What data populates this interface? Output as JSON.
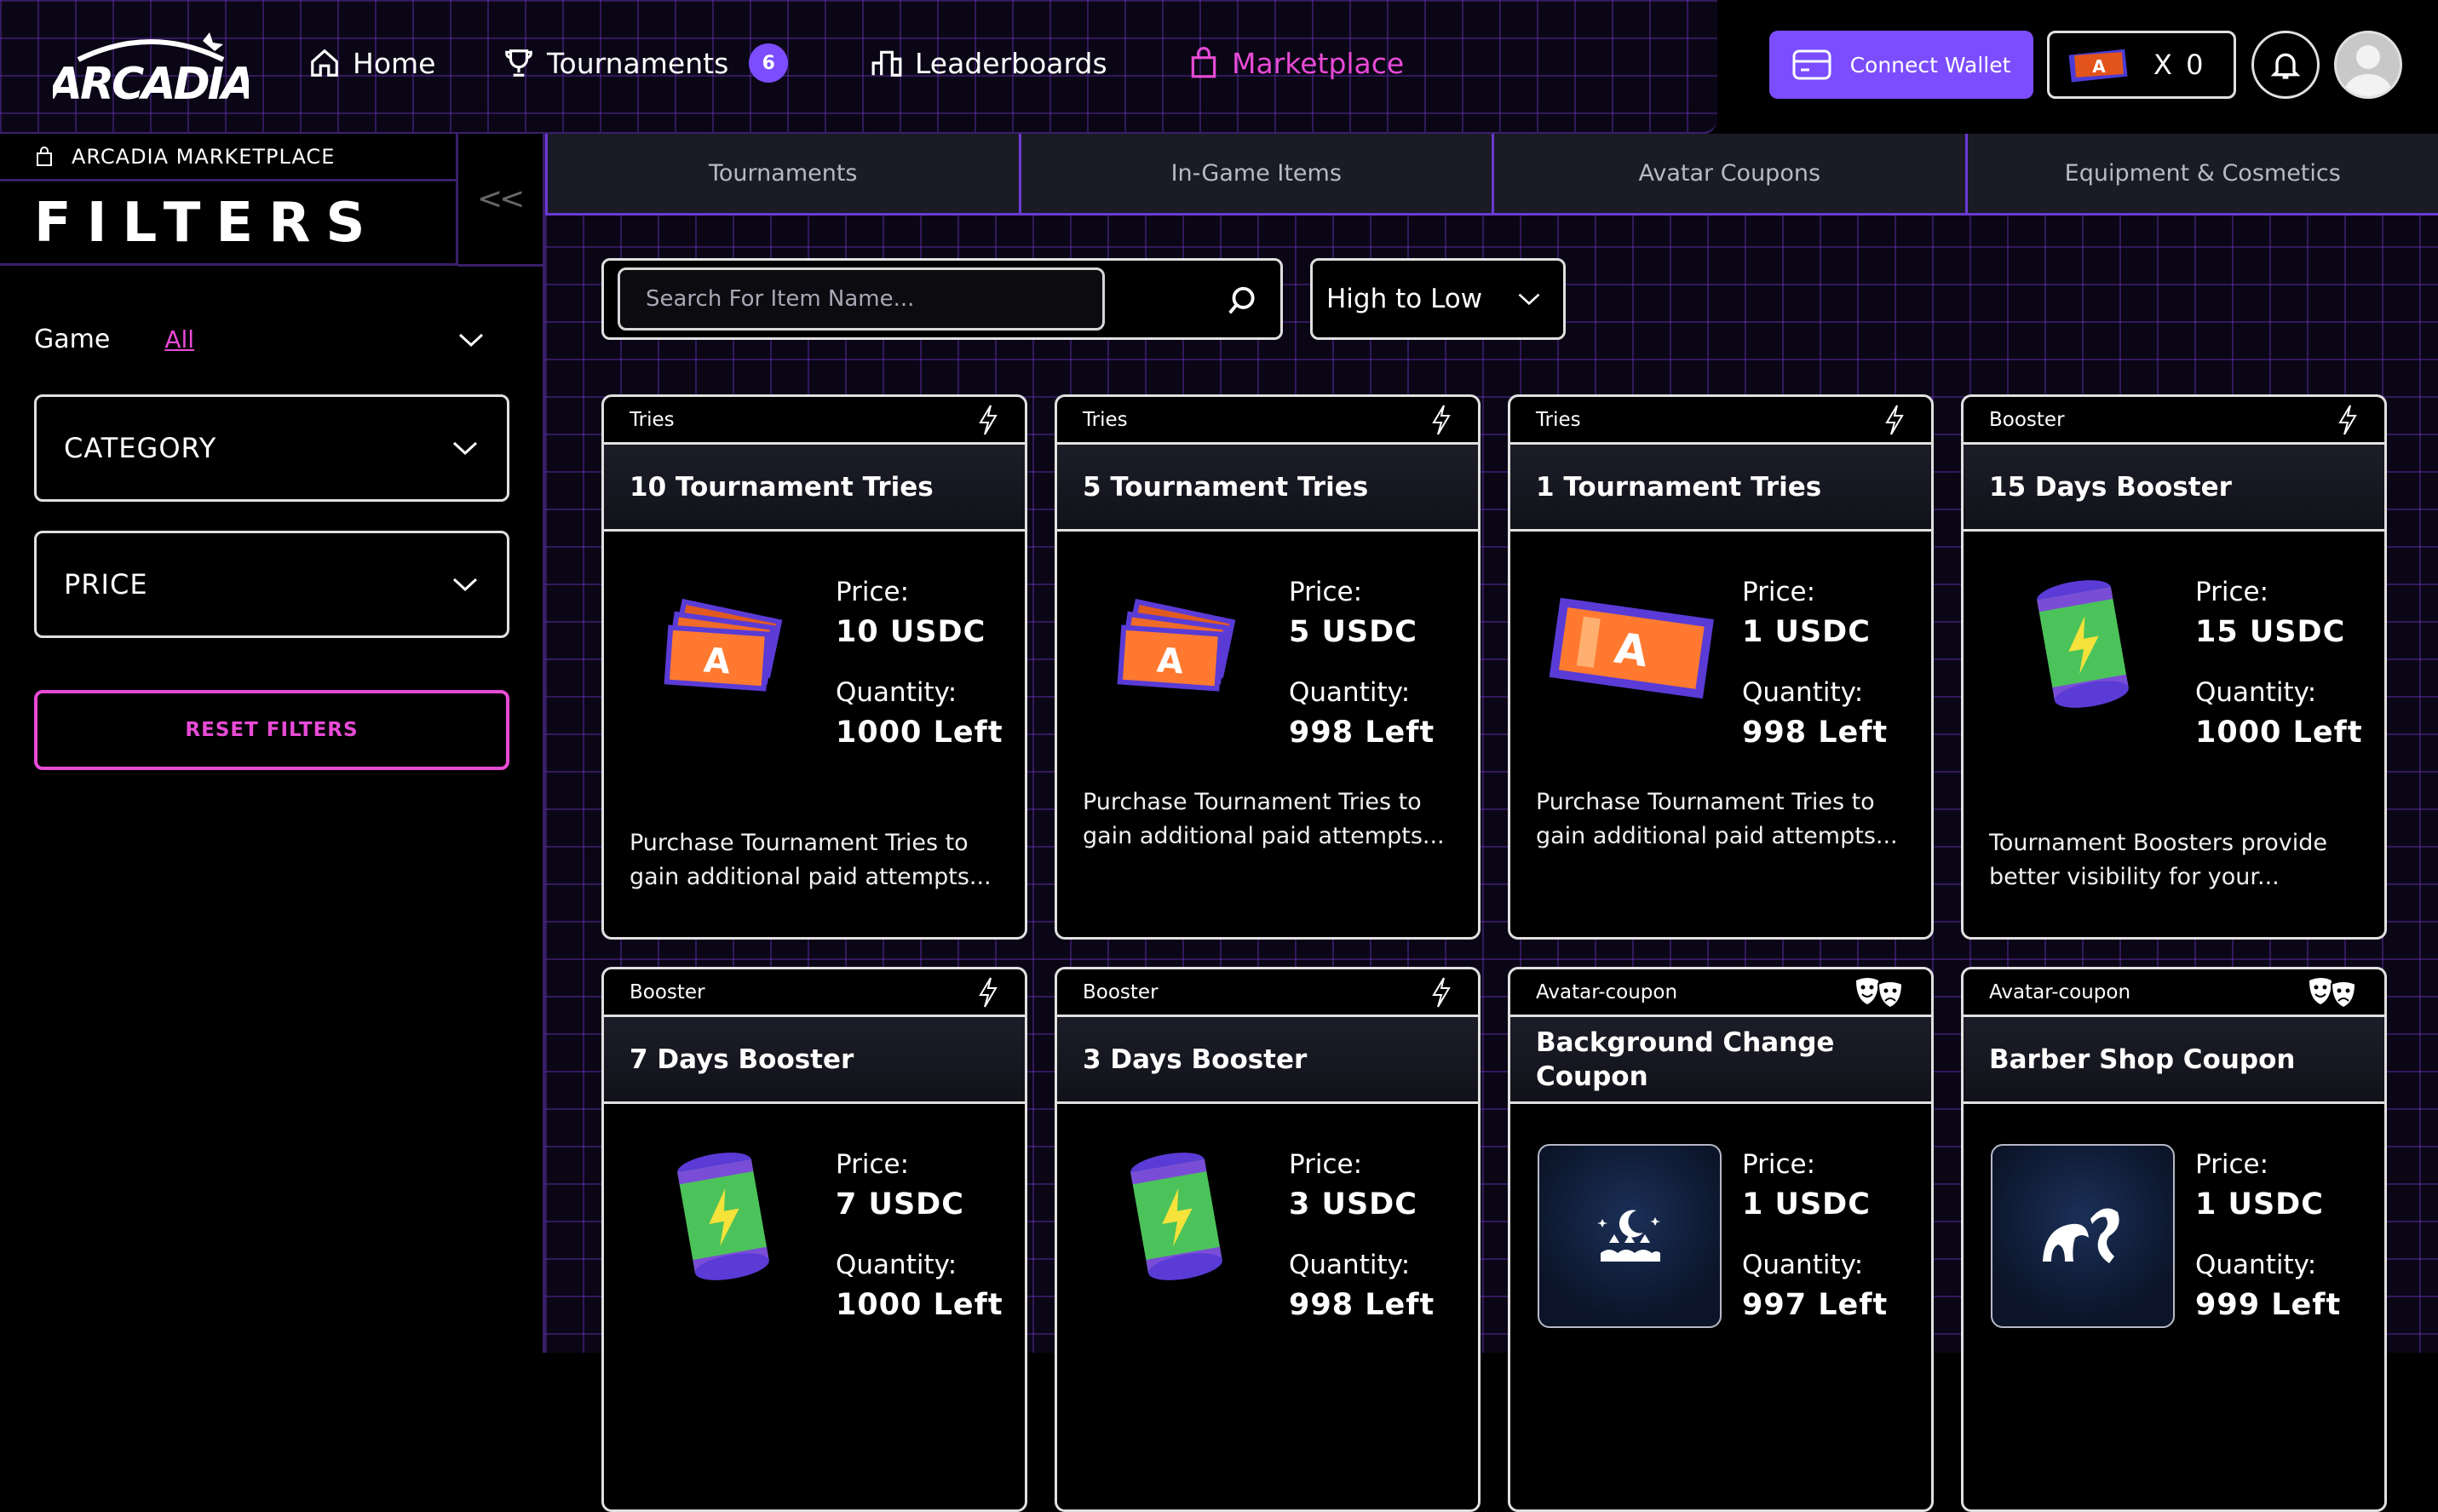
{
  "brand": {
    "logo_text": "ARCADIA"
  },
  "nav": {
    "home": "Home",
    "tournaments": "Tournaments",
    "tournaments_badge": "6",
    "leaderboards": "Leaderboards",
    "marketplace": "Marketplace"
  },
  "header": {
    "connect_wallet": "Connect Wallet",
    "tickets_count": "X 0"
  },
  "sidebar": {
    "section_label": "ARCADIA MARKETPLACE",
    "title": "FILTERS",
    "collapse_symbol": "<<",
    "game_label": "Game",
    "game_value": "All",
    "category_label": "CATEGORY",
    "price_label": "PRICE",
    "reset_label": "RESET FILTERS"
  },
  "tabs": [
    "Tournaments",
    "In-Game Items",
    "Avatar Coupons",
    "Equipment & Cosmetics"
  ],
  "search": {
    "placeholder": "Search For Item Name..."
  },
  "sort": {
    "value": "High to Low"
  },
  "labels": {
    "price": "Price:",
    "quantity": "Quantity:"
  },
  "cards": [
    {
      "type": "Tries",
      "icon": "lightning-icon",
      "title": "10 Tournament Tries",
      "price": "10 USDC",
      "quantity": "1000 Left",
      "description": "Purchase Tournament Tries to gain additional paid attempts..."
    },
    {
      "type": "Tries",
      "icon": "lightning-icon",
      "title": "5 Tournament Tries",
      "price": "5 USDC",
      "quantity": "998 Left",
      "description": "Purchase Tournament Tries to gain additional paid attempts..."
    },
    {
      "type": "Tries",
      "icon": "lightning-icon",
      "title": "1 Tournament Tries",
      "price": "1 USDC",
      "quantity": "998 Left",
      "description": "Purchase Tournament Tries to gain additional paid attempts..."
    },
    {
      "type": "Booster",
      "icon": "lightning-icon",
      "title": "15 Days Booster",
      "price": "15 USDC",
      "quantity": "1000 Left",
      "description": "Tournament Boosters provide better visibility for your..."
    },
    {
      "type": "Booster",
      "icon": "lightning-icon",
      "title": "7 Days Booster",
      "price": "7 USDC",
      "quantity": "1000 Left",
      "description": ""
    },
    {
      "type": "Booster",
      "icon": "lightning-icon",
      "title": "3 Days Booster",
      "price": "3 USDC",
      "quantity": "998 Left",
      "description": ""
    },
    {
      "type": "Avatar-coupon",
      "icon": "theater-masks-icon",
      "title": "Background Change Coupon",
      "price": "1 USDC",
      "quantity": "997 Left",
      "description": ""
    },
    {
      "type": "Avatar-coupon",
      "icon": "theater-masks-icon",
      "title": "Barber Shop Coupon",
      "price": "1 USDC",
      "quantity": "999 Left",
      "description": ""
    }
  ],
  "colors": {
    "accent": "#7b4dff",
    "pink": "#e84bd6",
    "grid": "#3a1f6a",
    "bg": "#0b0616"
  }
}
